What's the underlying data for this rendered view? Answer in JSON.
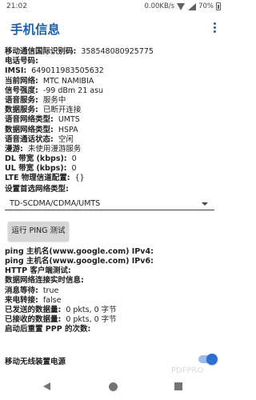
{
  "status_bar": {
    "time": "21:02",
    "speed": "0.00KB/s",
    "battery": "70%"
  },
  "app": {
    "title": "手机信息"
  },
  "info_rows": [
    {
      "k": "移动通信国际识别码:",
      "v": "358548080925775"
    },
    {
      "k": "电话号码:",
      "v": ""
    },
    {
      "k": "IMSI:",
      "v": "649011983505632"
    },
    {
      "k": "当前网络:",
      "v": "MTC NAMIBIA"
    },
    {
      "k": "信号强度:",
      "v": "-99 dBm  21 asu"
    },
    {
      "k": "语音服务:",
      "v": "服务中"
    },
    {
      "k": "数据服务:",
      "v": "已断开连接"
    },
    {
      "k": "语音网络类型:",
      "v": "UMTS"
    },
    {
      "k": "数据网络类型:",
      "v": "HSPA"
    },
    {
      "k": "语音通话状态:",
      "v": "空闲"
    },
    {
      "k": "漫游:",
      "v": "未使用漫游服务"
    },
    {
      "k": "DL 带宽 (kbps):",
      "v": "0"
    },
    {
      "k": "UL 带宽 (kbps):",
      "v": "0"
    },
    {
      "k": "LTE 物理信道配置:",
      "v": "{}"
    }
  ],
  "preferred_network": {
    "label": "设置首选网络类型:",
    "value": "TD-SCDMA/CDMA/UMTS"
  },
  "ping_button": {
    "label": "运行 PING 测试"
  },
  "ping_rows": [
    {
      "k": "ping 主机名(www.google.com) IPv4:",
      "v": ""
    },
    {
      "k": "ping 主机名(www.google.com) IPv6:",
      "v": ""
    },
    {
      "k": "HTTP 客户端测试:",
      "v": ""
    },
    {
      "k": "数据网络连接实时信息:",
      "v": ""
    },
    {
      "k": "消息等待:",
      "v": "true"
    },
    {
      "k": "来电转接:",
      "v": "false"
    },
    {
      "k": "已发送的数据量:",
      "v": "0 pkts, 0 字节"
    },
    {
      "k": "已接收的数据量:",
      "v": "0 pkts, 0 字节"
    },
    {
      "k": "启动后重置 PPP 的次数:",
      "v": ""
    }
  ],
  "radio_toggle": {
    "label": "移动无线装置电源",
    "on": true
  },
  "watermark": "PDFPRO"
}
